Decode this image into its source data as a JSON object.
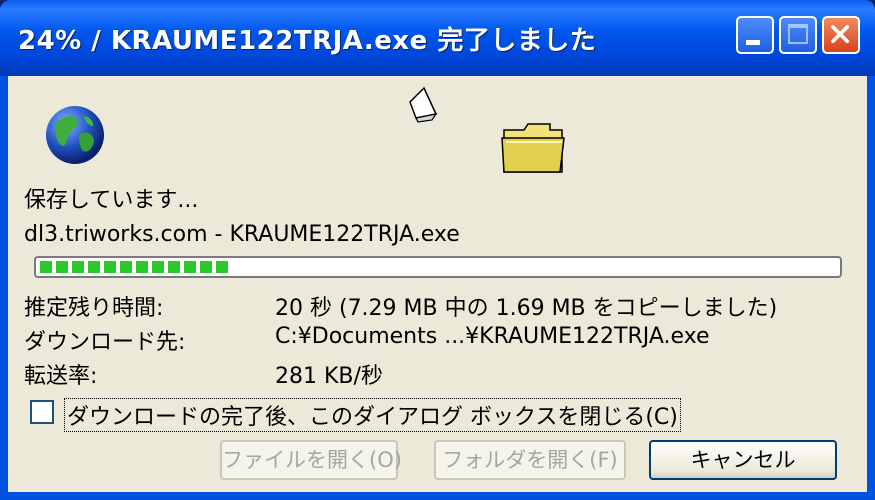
{
  "window": {
    "title": "24% / KRAUME122TRJA.exe 完了しました",
    "minimize_icon": "minimize-icon",
    "maximize_icon": "maximize-icon",
    "close_icon": "close-icon"
  },
  "icons": {
    "globe": "globe-icon",
    "paper": "flying-document-icon",
    "folder": "folder-icon"
  },
  "status_text": "保存しています...",
  "source_text": "dl3.triworks.com - KRAUME122TRJA.exe",
  "progress": {
    "fraction": 0.24,
    "accent": "#2ec82e"
  },
  "details": {
    "time_label": "推定残り時間:",
    "time_value": "20 秒 (7.29 MB 中の 1.69 MB をコピーしました)",
    "dest_label": "ダウンロード先:",
    "dest_value": "C:¥Documents ...¥KRAUME122TRJA.exe",
    "rate_label": "転送率:",
    "rate_value": "281 KB/秒"
  },
  "close_on_complete": {
    "label": "ダウンロードの完了後、このダイアログ ボックスを閉じる(C)",
    "checked": false
  },
  "buttons": {
    "open_file": "ファイルを開く(O)",
    "open_folder": "フォルダを開く(F)",
    "cancel": "キャンセル"
  },
  "colors": {
    "titlebar": "#0058ee",
    "close_button": "#d8431c",
    "dialog_bg": "#ece9d8"
  }
}
